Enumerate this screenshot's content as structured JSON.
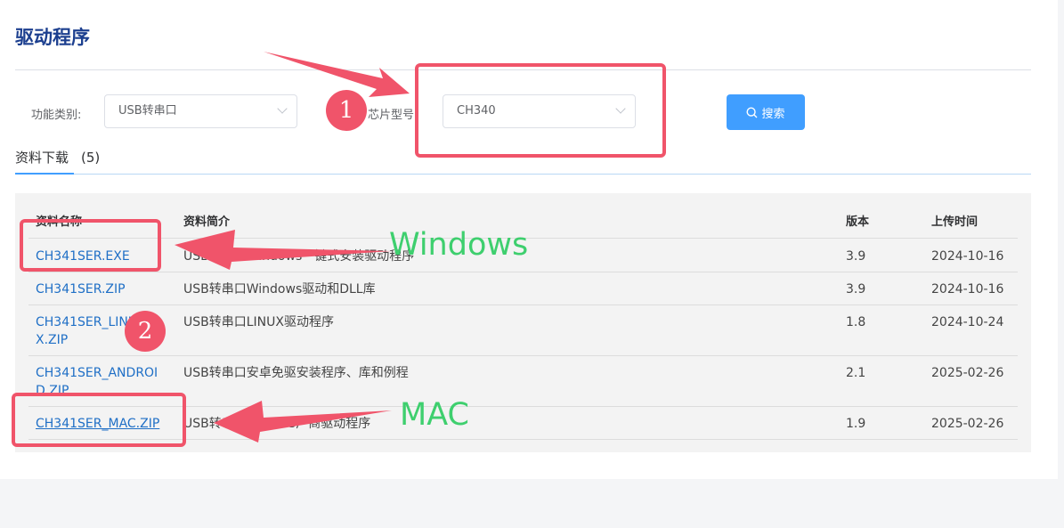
{
  "page": {
    "title": "驱动程序"
  },
  "filters": {
    "category_label": "功能类别:",
    "category_value": "USB转串口",
    "chip_label": "芯片型号:",
    "chip_value": "CH340",
    "search_label": "搜索"
  },
  "tab": {
    "label": "资料下载",
    "count": "(5)"
  },
  "table": {
    "headers": {
      "name": "资料名称",
      "desc": "资料简介",
      "version": "版本",
      "date": "上传时间"
    },
    "rows": [
      {
        "name": "CH341SER.EXE",
        "desc": "USB转串口Windows一键式安装驱动程序",
        "version": "3.9",
        "date": "2024-10-16"
      },
      {
        "name": "CH341SER.ZIP",
        "desc": "USB转串口Windows驱动和DLL库",
        "version": "3.9",
        "date": "2024-10-16"
      },
      {
        "name": "CH341SER_LINUX.ZIP",
        "desc": "USB转串口LINUX驱动程序",
        "version": "1.8",
        "date": "2024-10-24"
      },
      {
        "name": "CH341SER_ANDROID.ZIP",
        "desc": "USB转串口安卓免驱安装程序、库和例程",
        "version": "2.1",
        "date": "2025-02-26"
      },
      {
        "name": "CH341SER_MAC.ZIP",
        "desc": "USB转串口MAC OS广商驱动程序",
        "version": "1.9",
        "date": "2025-02-26"
      }
    ]
  },
  "annotations": {
    "marker1": "1",
    "marker2": "2",
    "windows_label": "Windows",
    "mac_label": "MAC",
    "color": "#f0546a",
    "text_color": "#3ecf6e"
  },
  "colors": {
    "title": "#1c3f8f",
    "link": "#1f6fc6",
    "button": "#409eff"
  }
}
